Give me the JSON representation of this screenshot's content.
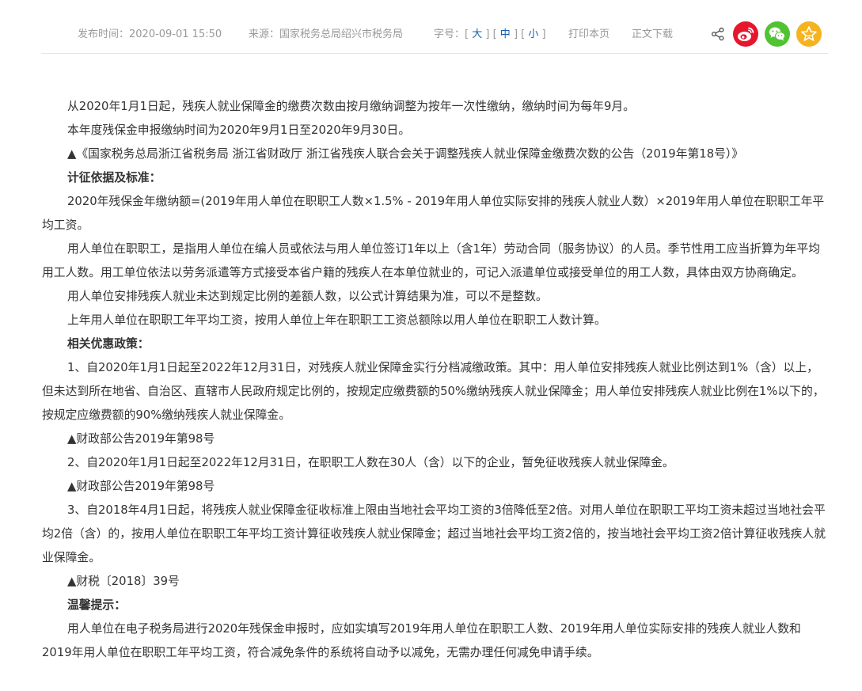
{
  "meta": {
    "publish_time": "发布时间：2020-09-01  15:50",
    "source": "来源：国家税务总局绍兴市税务局",
    "fontsize_label": "字号：",
    "fontsize_large": "大",
    "fontsize_medium": "中",
    "fontsize_small": "小",
    "print": "打印本页",
    "download": "正文下载"
  },
  "share": {
    "icons": [
      "share-icon",
      "weibo-icon",
      "wechat-icon",
      "favorite-star-icon"
    ],
    "colors": {
      "weibo": "#e6162d",
      "wechat": "#51c332",
      "favorite": "#f5b320"
    }
  },
  "article": {
    "paragraphs": [
      "从2020年1月1日起，残疾人就业保障金的缴费次数由按月缴纳调整为按年一次性缴纳，缴纳时间为每年9月。",
      "本年度残保金申报缴纳时间为2020年9月1日至2020年9月30日。",
      "▲《国家税务总局浙江省税务局 浙江省财政厅 浙江省残疾人联合会关于调整残疾人就业保障金缴费次数的公告（2019年第18号）》",
      "计征依据及标准：",
      "2020年残保金年缴纳额=(2019年用人单位在职职工人数×1.5% - 2019年用人单位实际安排的残疾人就业人数）×2019年用人单位在职职工年平均工资。",
      "用人单位在职职工，是指用人单位在编人员或依法与用人单位签订1年以上（含1年）劳动合同（服务协议）的人员。季节性用工应当折算为年平均用工人数。用工单位依法以劳务派遣等方式接受本省户籍的残疾人在本单位就业的，可记入派遣单位或接受单位的用工人数，具体由双方协商确定。",
      "用人单位安排残疾人就业未达到规定比例的差额人数，以公式计算结果为准，可以不是整数。",
      "上年用人单位在职职工年平均工资，按用人单位上年在职职工工资总额除以用人单位在职职工人数计算。",
      "相关优惠政策：",
      "1、自2020年1月1日起至2022年12月31日，对残疾人就业保障金实行分档减缴政策。其中：用人单位安排残疾人就业比例达到1%（含）以上，但未达到所在地省、自治区、直辖市人民政府规定比例的，按规定应缴费额的50%缴纳残疾人就业保障金；用人单位安排残疾人就业比例在1%以下的，按规定应缴费额的90%缴纳残疾人就业保障金。",
      "▲财政部公告2019年第98号",
      "2、自2020年1月1日起至2022年12月31日，在职职工人数在30人（含）以下的企业，暂免征收残疾人就业保障金。",
      "▲财政部公告2019年第98号",
      "3、自2018年4月1日起，将残疾人就业保障金征收标准上限由当地社会平均工资的3倍降低至2倍。对用人单位在职职工平均工资未超过当地社会平均2倍（含）的，按用人单位在职职工年平均工资计算征收残疾人就业保障金；超过当地社会平均工资2倍的，按当地社会平均工资2倍计算征收残疾人就业保障金。",
      "▲财税〔2018〕39号",
      "温馨提示：",
      "用人单位在电子税务局进行2020年残保金申报时，应如实填写2019年用人单位在职职工人数、2019年用人单位实际安排的残疾人就业人数和2019年用人单位在职职工年平均工资，符合减免条件的系统将自动予以减免，无需办理任何减免申请手续。"
    ]
  }
}
